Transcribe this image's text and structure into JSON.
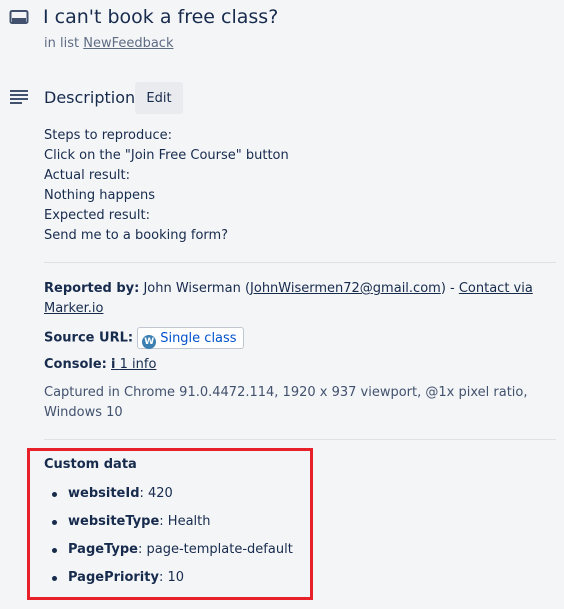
{
  "card": {
    "title": "I can't book a free class?",
    "in_list_prefix": "in list",
    "list_name": "NewFeedback",
    "icon": "card-icon"
  },
  "description": {
    "heading": "Description",
    "edit_label": "Edit",
    "icon": "description-lines-icon",
    "steps": [
      "Steps to reproduce:",
      "Click on the \"Join Free Course\" button",
      "Actual result:",
      "Nothing happens",
      "Expected result:",
      "Send me to a booking form?"
    ]
  },
  "report": {
    "reported_by_label": "Reported by:",
    "reporter_name": "John Wiserman",
    "reporter_email": "JohnWisermen72@gmail.com",
    "contact_link": "Contact via Marker.io",
    "source_url_label": "Source URL:",
    "source_url_text": "Single class",
    "source_icon": "wordpress-icon",
    "console_label": "Console:",
    "console_info_icon": "info-icon",
    "console_value": "1 info",
    "captured": "Captured in Chrome 91.0.4472.114, 1920 x 937 viewport, @1x pixel ratio, Windows 10"
  },
  "custom_data": {
    "title": "Custom data",
    "items": [
      {
        "key": "websiteId",
        "value": "420"
      },
      {
        "key": "websiteType",
        "value": "Health"
      },
      {
        "key": "PageType",
        "value": "page-template-default"
      },
      {
        "key": "PagePriority",
        "value": "10"
      }
    ]
  },
  "colors": {
    "highlight_border": "#e8202a",
    "link_blue": "#0052cc",
    "text": "#172b4d",
    "muted": "#5e6c84"
  }
}
